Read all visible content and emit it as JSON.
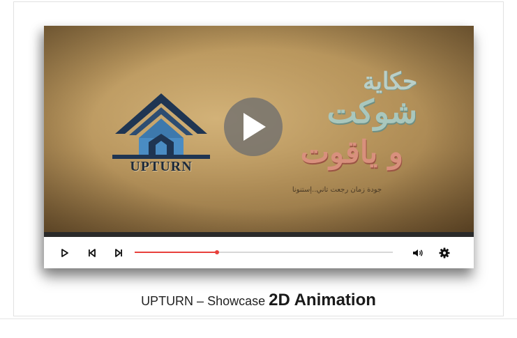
{
  "video": {
    "logo_text": "UPTURN",
    "title_line1": "حكاية",
    "title_line2": "شوكت",
    "title_line3": "و ياقوت",
    "subtitle": "جودة زمان رجعت تاني..إستنونا",
    "progress": 0.32
  },
  "controls": {
    "play_icon": "play-icon",
    "prev_icon": "skip-previous-icon",
    "next_icon": "skip-next-icon",
    "volume_icon": "volume-icon",
    "settings_icon": "gear-icon"
  },
  "caption": {
    "prefix": "UPTURN  – Showcase ",
    "emphasis": "2D Animation"
  },
  "colors": {
    "accent": "#e8403b",
    "control_icon": "#111111"
  }
}
